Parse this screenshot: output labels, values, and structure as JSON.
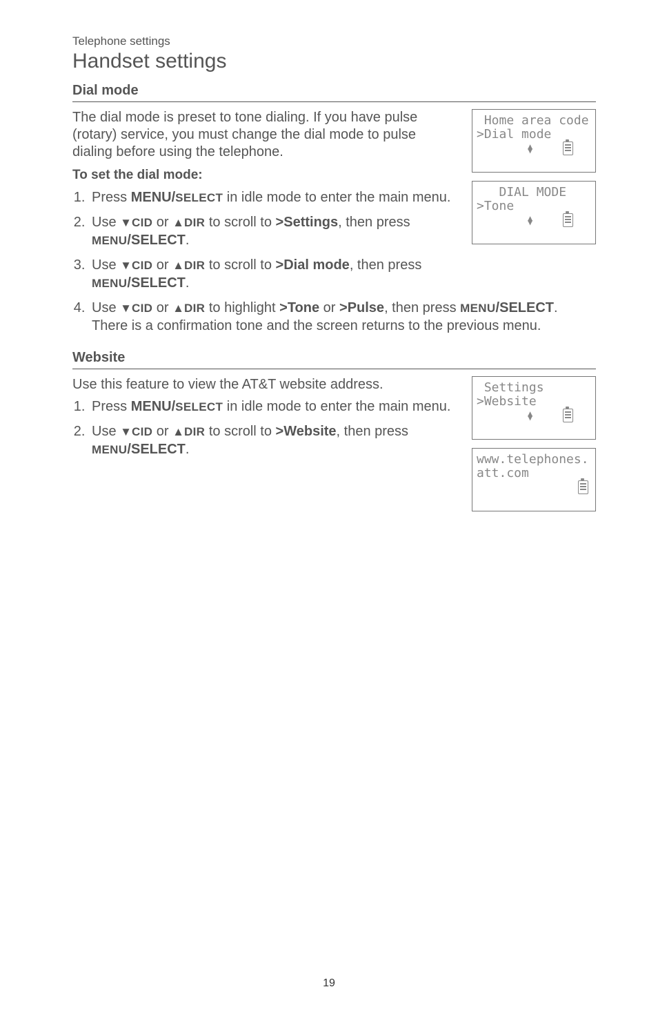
{
  "header": {
    "breadcrumb": "Telephone settings",
    "title": "Handset settings"
  },
  "dial_mode": {
    "heading": "Dial mode",
    "intro": "The dial mode is preset to tone dialing. If you have pulse (rotary) service, you must change the dial mode to pulse dialing before using the telephone.",
    "to_set": "To set the dial mode:",
    "steps": {
      "s1_a": "Press ",
      "s1_b": "MENU/",
      "s1_c": "SELECT",
      "s1_d": " in idle mode to enter the main menu.",
      "s2_a": "Use ",
      "cid": "CID",
      "or": " or ",
      "dir": "DIR",
      "s2_b": " to scroll to ",
      "s2_target": ">Settings",
      "s2_c": ", then press ",
      "menu_select_a": "MENU",
      "menu_select_b": "/SELECT",
      "period": ".",
      "s3_b": " to scroll to ",
      "s3_target": ">Dial mode",
      "s3_c": ", then press ",
      "s4_b": " to highlight ",
      "s4_tone": ">Tone",
      "s4_or": " or ",
      "s4_pulse": ">Pulse",
      "s4_c": ", then press ",
      "s4_d": ". There is a confirmation tone and the screen returns to the previous menu."
    },
    "screens": {
      "scr1_line1": " Home area code",
      "scr1_line2": ">Dial mode",
      "scr2_line1": "   DIAL MODE",
      "scr2_line2": ">Tone"
    }
  },
  "website": {
    "heading": "Website",
    "intro": "Use this feature to view the AT&T website address.",
    "steps": {
      "s1_a": "Press ",
      "s1_b": "MENU/",
      "s1_c": "SELECT",
      "s1_d": " in idle mode to enter the main menu.",
      "s2_a": "Use ",
      "s2_b": " to scroll to ",
      "s2_target": ">Website",
      "s2_c": ", then press "
    },
    "screens": {
      "scr1_line1": " Settings",
      "scr1_line2": ">Website",
      "scr2_line1": "www.telephones.",
      "scr2_line2": "att.com"
    }
  },
  "page_number": "19"
}
